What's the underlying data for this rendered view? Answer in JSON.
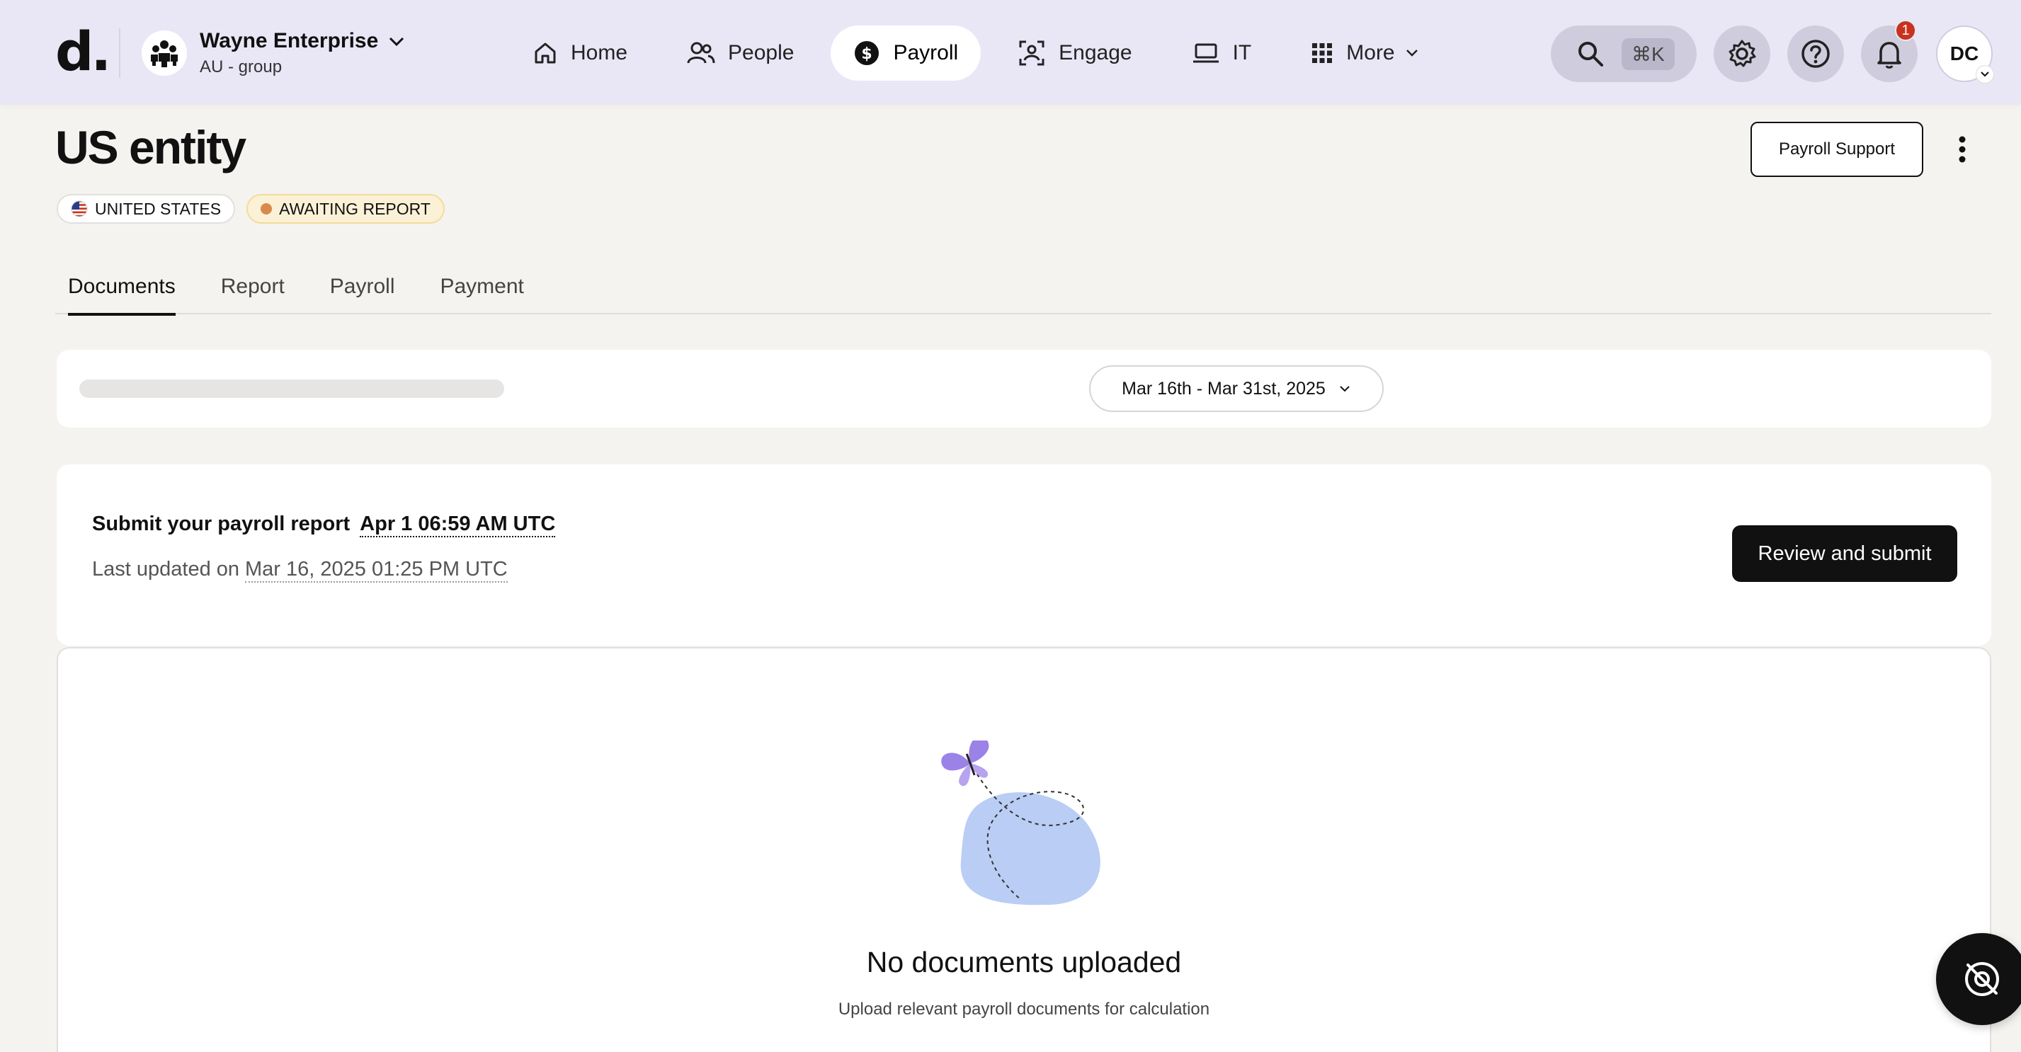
{
  "brand": {
    "logo": "d."
  },
  "org": {
    "name": "Wayne Enterprise",
    "subtitle": "AU - group"
  },
  "nav": {
    "items": [
      {
        "label": "Home",
        "icon": "home-icon"
      },
      {
        "label": "People",
        "icon": "people-icon"
      },
      {
        "label": "Payroll",
        "icon": "dollar-icon",
        "active": true
      },
      {
        "label": "Engage",
        "icon": "engage-icon"
      },
      {
        "label": "IT",
        "icon": "laptop-icon"
      },
      {
        "label": "More",
        "icon": "grid-icon"
      }
    ]
  },
  "toolbar": {
    "search_shortcut": "⌘K",
    "notifications_count": "1",
    "avatar_initials": "DC"
  },
  "page": {
    "title": "US entity",
    "tags": {
      "country": "UNITED STATES",
      "status": "AWAITING REPORT"
    },
    "support_button": "Payroll Support"
  },
  "tabs": [
    "Documents",
    "Report",
    "Payroll",
    "Payment"
  ],
  "filter": {
    "date_range": "Mar 16th - Mar 31st, 2025"
  },
  "submit": {
    "label": "Submit your payroll report",
    "deadline": "Apr 1 06:59 AM UTC",
    "updated_label": "Last updated on",
    "updated_value": "Mar 16, 2025 01:25 PM UTC",
    "button": "Review and submit"
  },
  "empty_state": {
    "title": "No documents uploaded",
    "subtitle": "Upload relevant payroll documents for calculation"
  },
  "colors": {
    "topbar_bg": "#e9e7f6",
    "page_bg": "#f4f3f0",
    "badge_red": "#c8321e",
    "status_dot": "#d98a4a",
    "blob_blue": "#b9cdf5",
    "butterfly_purple": "#9b82e6"
  }
}
